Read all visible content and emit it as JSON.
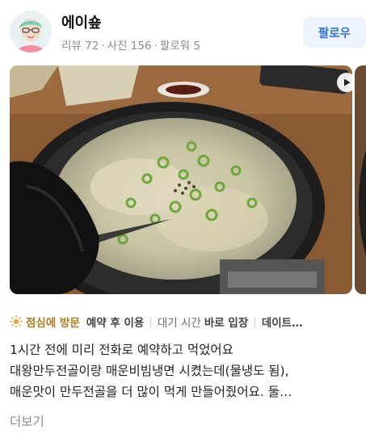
{
  "profile": {
    "name": "에이숖",
    "stats": {
      "reviews": "리뷰 72",
      "photos": "사진 156",
      "followers": "팔로워 5",
      "separator": "·"
    },
    "follow_label": "팔로우",
    "avatar_icon": "user-avatar-icon"
  },
  "media": {
    "main_photo_icon": "food-photo-icon",
    "next_photo_icon": "food-photo-icon",
    "video_icon": "play-icon"
  },
  "tags": {
    "sun_icon": "sun-icon",
    "visit_prefix": "점심에 방문",
    "reservation_label": "예약 후 이용",
    "wait_label": "대기 시간",
    "wait_value": "바로 입장",
    "purpose_label": "데이트…",
    "separator": "|"
  },
  "review": {
    "lines": [
      "1시간 전에 미리 전화로 예약하고 먹었어요",
      "대왕만두전골이랑 매운비빔냉면 시켰는데(물냉도 됨),",
      "매운맛이 만두전골을 더 많이 먹게 만들어줬어요. 둘…"
    ],
    "more_label": "더보기"
  },
  "colors": {
    "follow_bg": "#eef4ff",
    "follow_text": "#2f6fe4",
    "tag_accent": "#b07a1e",
    "muted": "#8a8a8a"
  }
}
